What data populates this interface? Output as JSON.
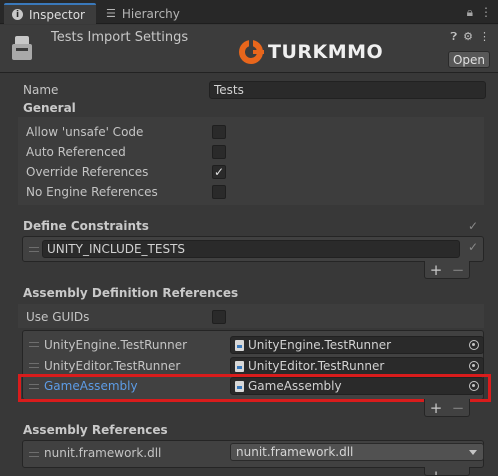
{
  "tabs": [
    {
      "label": "Inspector",
      "icon": "info-icon"
    },
    {
      "label": "Hierarchy",
      "icon": "hierarchy-icon"
    }
  ],
  "header": {
    "title": "Tests Import Settings",
    "open_label": "Open",
    "watermark": "TURKMMO"
  },
  "name_field": {
    "label": "Name",
    "value": "Tests"
  },
  "general": {
    "title": "General",
    "options": [
      {
        "label": "Allow 'unsafe' Code",
        "checked": false
      },
      {
        "label": "Auto Referenced",
        "checked": false
      },
      {
        "label": "Override References",
        "checked": true
      },
      {
        "label": "No Engine References",
        "checked": false
      }
    ]
  },
  "define_constraints": {
    "title": "Define Constraints",
    "items": [
      "UNITY_INCLUDE_TESTS"
    ]
  },
  "asm_def_refs": {
    "title": "Assembly Definition References",
    "use_guids_label": "Use GUIDs",
    "items": [
      {
        "label": "UnityEngine.TestRunner",
        "value": "UnityEngine.TestRunner"
      },
      {
        "label": "UnityEditor.TestRunner",
        "value": "UnityEditor.TestRunner"
      },
      {
        "label": "GameAssembly",
        "value": "GameAssembly"
      }
    ]
  },
  "asm_refs": {
    "title": "Assembly References",
    "items": [
      {
        "label": "nunit.framework.dll",
        "value": "nunit.framework.dll"
      }
    ]
  },
  "controls": {
    "plus": "+",
    "minus": "−"
  },
  "colors": {
    "accent_tab": "#3a79bb",
    "highlight_border": "#d91c1c",
    "selected_label": "#5d9ce6",
    "logo_orange": "#e8661c"
  }
}
